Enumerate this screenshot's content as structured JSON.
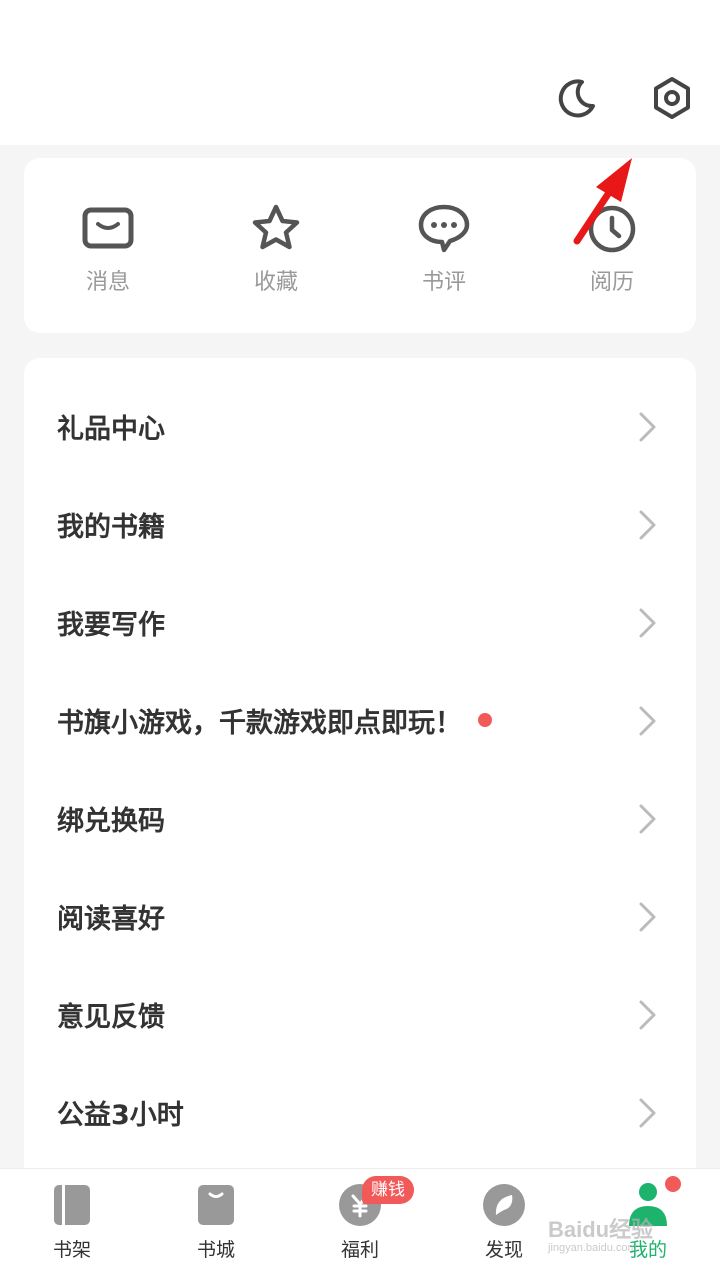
{
  "header": {
    "icons": [
      "moon-icon",
      "settings-hexagon-icon"
    ]
  },
  "quick_links": [
    {
      "label": "消息",
      "icon": "envelope-icon"
    },
    {
      "label": "收藏",
      "icon": "star-icon"
    },
    {
      "label": "书评",
      "icon": "chat-bubble-icon"
    },
    {
      "label": "阅历",
      "icon": "clock-icon"
    }
  ],
  "menu": [
    {
      "label": "礼品中心",
      "dot": false
    },
    {
      "label": "我的书籍",
      "dot": false
    },
    {
      "label": "我要写作",
      "dot": false
    },
    {
      "label": "书旗小游戏，千款游戏即点即玩！",
      "dot": true
    },
    {
      "label": "绑兑换码",
      "dot": false
    },
    {
      "label": "阅读喜好",
      "dot": false
    },
    {
      "label": "意见反馈",
      "dot": false
    },
    {
      "label": "公益3小时",
      "dot": false
    }
  ],
  "tabbar": {
    "tabs": [
      {
        "label": "书架",
        "icon": "bookshelf-icon",
        "active": false
      },
      {
        "label": "书城",
        "icon": "bookstore-bag-icon",
        "active": false
      },
      {
        "label": "福利",
        "icon": "yuan-coin-icon",
        "active": false
      },
      {
        "label": "发现",
        "icon": "compass-icon",
        "active": false
      },
      {
        "label": "我的",
        "icon": "profile-person-icon",
        "active": true
      }
    ],
    "earn_badge": "赚钱"
  },
  "watermark": {
    "main": "Baidu经验",
    "sub": "jingyan.baidu.com"
  },
  "colors": {
    "accent_green": "#1db36c",
    "badge_red": "#f25a5a",
    "icon_gray": "#555555",
    "label_gray": "#999999"
  }
}
